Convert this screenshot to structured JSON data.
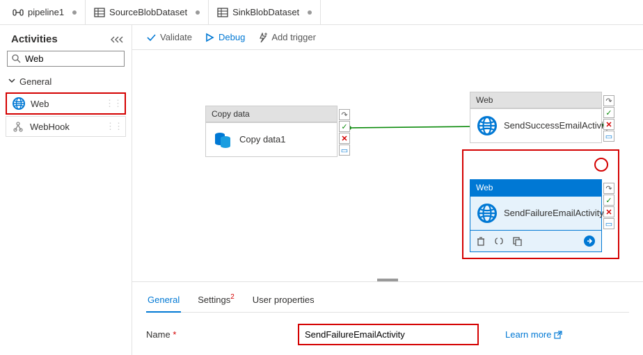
{
  "tabs": [
    {
      "icon": "pipeline",
      "label": "pipeline1",
      "dirty": true
    },
    {
      "icon": "dataset",
      "label": "SourceBlobDataset",
      "dirty": true
    },
    {
      "icon": "dataset",
      "label": "SinkBlobDataset",
      "dirty": true
    }
  ],
  "sidebar": {
    "title": "Activities",
    "search_icon": "search",
    "search_value": "Web",
    "group_label": "General",
    "items": [
      {
        "icon": "web",
        "label": "Web"
      },
      {
        "icon": "webhook",
        "label": "WebHook"
      }
    ]
  },
  "toolbar": {
    "validate": "Validate",
    "debug": "Debug",
    "add_trigger": "Add trigger"
  },
  "canvas": {
    "copy": {
      "header": "Copy data",
      "label": "Copy data1"
    },
    "success": {
      "header": "Web",
      "label": "SendSuccessEmailActivity"
    },
    "failure": {
      "header": "Web",
      "label": "SendFailureEmailActivity"
    }
  },
  "bottom": {
    "tabs": {
      "general": "General",
      "settings": "Settings",
      "settings_badge": "2",
      "user_props": "User properties"
    },
    "name_label": "Name",
    "name_value": "SendFailureEmailActivity",
    "learn_more": "Learn more"
  }
}
